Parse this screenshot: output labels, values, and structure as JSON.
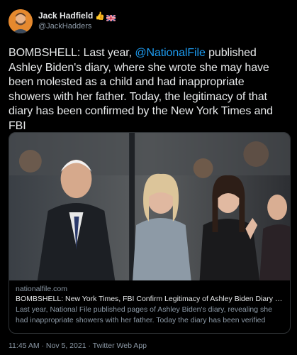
{
  "author": {
    "display_name": "Jack Hadfield",
    "emoji": "👍",
    "flag_icon": "uk-flag-icon",
    "handle": "@JackHadders"
  },
  "tweet": {
    "text_before": "BOMBSHELL: Last year, ",
    "mention": "@NationalFile",
    "text_after": " published Ashley Biden's diary, where she wrote she may have been molested as a child and had inappropriate showers with her father. Today, the legitimacy of that diary has been confirmed by the New York Times and FBI"
  },
  "card": {
    "domain": "nationalfile.com",
    "title": "BOMBSHELL: New York Times, FBI Confirm Legitimacy of Ashley Biden Diary P...",
    "description": "Last year, National File published pages of Ashley Biden's diary, revealing she had inappropriate showers with her father. Today the diary has been verified"
  },
  "footer": {
    "timestamp": "11:45 AM · Nov 5, 2021 · Twitter Web App"
  },
  "colors": {
    "background": "#000000",
    "text": "#e7e9ea",
    "muted": "#8b98a5",
    "link": "#1d9bf0",
    "border": "#2f3336"
  }
}
